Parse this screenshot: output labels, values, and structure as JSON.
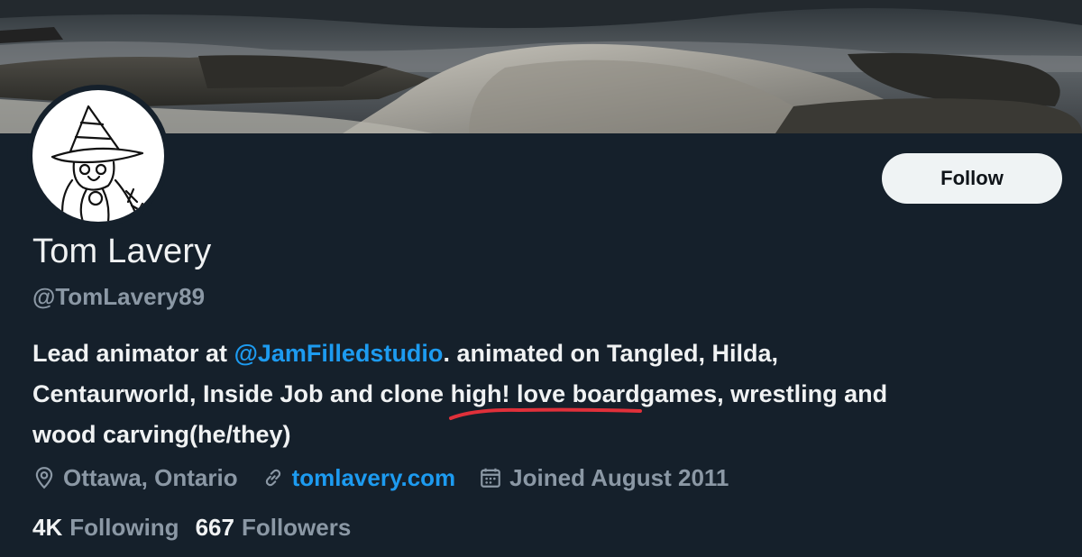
{
  "profile": {
    "name": "Tom Lavery",
    "handle": "@TomLavery89",
    "follow_label": "Follow"
  },
  "bio": {
    "part1": "Lead animator at ",
    "mention": "@JamFilledstudio",
    "part2": ". animated on Tangled, Hilda,",
    "part3": "Centaurworld, Inside Job and ",
    "highlight": "clone high! lo",
    "part4": "ve boardgames, wrestling and",
    "part5": "wood carving(he/they)"
  },
  "meta": {
    "location": "Ottawa, Ontario",
    "website": "tomlavery.com",
    "joined": "Joined August 2011",
    "location_icon": "location-pin-icon",
    "website_icon": "link-icon",
    "joined_icon": "calendar-icon"
  },
  "stats": {
    "following_count": "4K",
    "following_label": "Following",
    "followers_count": "667",
    "followers_label": "Followers"
  },
  "colors": {
    "background": "#15202b",
    "accent": "#1d9bf0",
    "secondary_text": "#8b98a5",
    "annotation_red": "#e0303a"
  }
}
